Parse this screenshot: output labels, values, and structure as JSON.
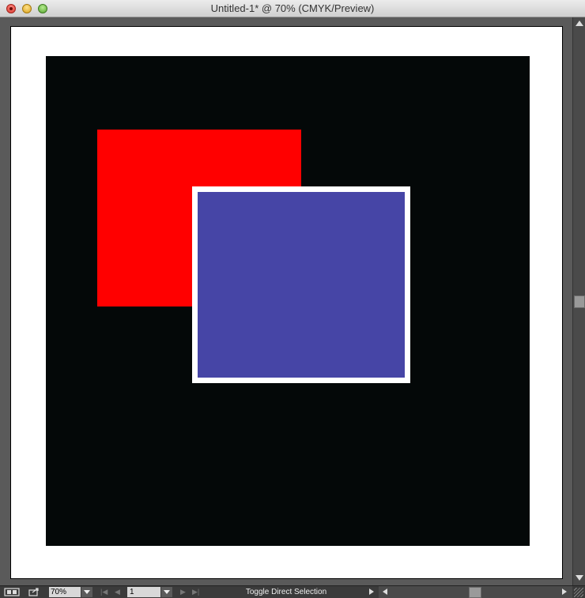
{
  "window": {
    "title": "Untitled-1* @ 70% (CMYK/Preview)"
  },
  "canvas": {
    "colors": {
      "artboard_background": "#ffffff",
      "black_rect": "#040808",
      "red_rect": "#ff0000",
      "blue_rect": "#4645a6",
      "blue_rect_stroke": "#ffffff"
    }
  },
  "statusbar": {
    "zoom_value": "70%",
    "page_value": "1",
    "status_text": "Toggle Direct Selection",
    "icons": {
      "artboard_nav": "artboard-nav-icon",
      "export": "share-icon",
      "first": "first-page-icon",
      "prev": "prev-page-icon",
      "next": "next-page-icon",
      "last": "last-page-icon"
    }
  }
}
